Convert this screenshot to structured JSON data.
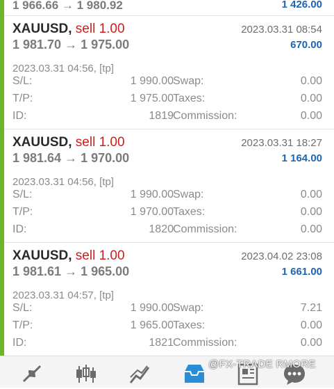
{
  "partial_trade": {
    "prices": "1 966.66 → 1 980.92",
    "profit": "1 426.00"
  },
  "trades": [
    {
      "symbol": "XAUUSD,",
      "side": "sell 1.00",
      "close_time": "2023.03.31 08:54",
      "prices": "1 981.70 → 1 975.00",
      "profit": "670.00",
      "open_info": "2023.03.31 04:56, [tp]",
      "sl_label": "S/L:",
      "sl": "1 990.00",
      "tp_label": "T/P:",
      "tp": "1 975.00",
      "id_label": "ID:",
      "id": "1819",
      "swap_label": "Swap:",
      "swap": "0.00",
      "taxes_label": "Taxes:",
      "taxes": "0.00",
      "commission_label": "Commission:",
      "commission": "0.00"
    },
    {
      "symbol": "XAUUSD,",
      "side": "sell 1.00",
      "close_time": "2023.03.31 18:27",
      "prices": "1 981.64 → 1 970.00",
      "profit": "1 164.00",
      "open_info": "2023.03.31 04:56, [tp]",
      "sl_label": "S/L:",
      "sl": "1 990.00",
      "tp_label": "T/P:",
      "tp": "1 970.00",
      "id_label": "ID:",
      "id": "1820",
      "swap_label": "Swap:",
      "swap": "0.00",
      "taxes_label": "Taxes:",
      "taxes": "0.00",
      "commission_label": "Commission:",
      "commission": "0.00"
    },
    {
      "symbol": "XAUUSD,",
      "side": "sell 1.00",
      "close_time": "2023.04.02 23:08",
      "prices": "1 981.61 → 1 965.00",
      "profit": "1 661.00",
      "open_info": "2023.03.31 04:57, [tp]",
      "sl_label": "S/L:",
      "sl": "1 990.00",
      "tp_label": "T/P:",
      "tp": "1 965.00",
      "id_label": "ID:",
      "id": "1821",
      "swap_label": "Swap:",
      "swap": "7.21",
      "taxes_label": "Taxes:",
      "taxes": "0.00",
      "commission_label": "Commission:",
      "commission": "0.00"
    }
  ],
  "bottom_nav": {
    "items": [
      "quotes-icon",
      "chart-icon",
      "trade-icon",
      "history-icon",
      "news-icon",
      "messages-icon"
    ],
    "active": "history-icon"
  },
  "watermark": "@FX-TRADE RMORE",
  "colors": {
    "profit_bar": "#6cb52a",
    "sell": "#c8201e",
    "profit_text": "#1c64b4",
    "active_nav": "#2a8ed6"
  }
}
